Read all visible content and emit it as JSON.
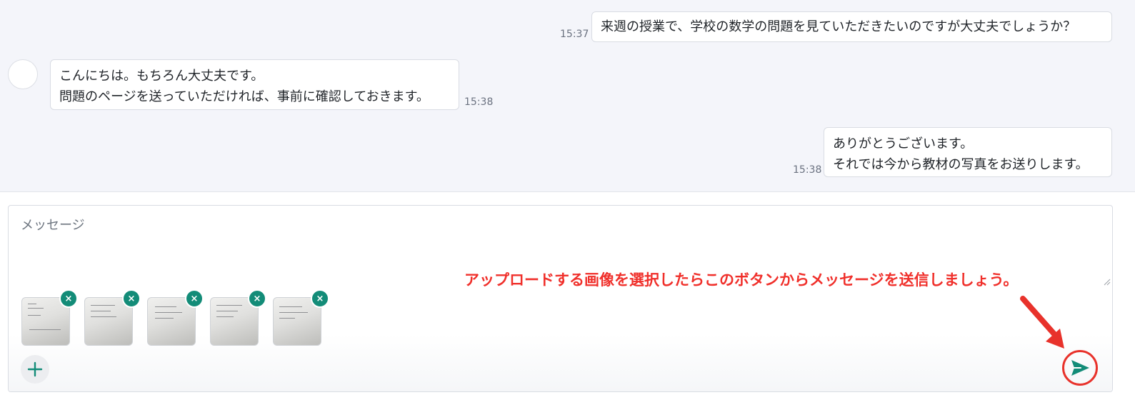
{
  "messages": [
    {
      "side": "right",
      "text": "来週の授業で、学校の数学の問題を見ていただきたいのですが大丈夫でしょうか？",
      "time": "15:37"
    },
    {
      "side": "left",
      "text": "こんにちは。もちろん大丈夫です。\n問題のページを送っていただければ、事前に確認しておきます。",
      "time": "15:38"
    },
    {
      "side": "right",
      "text": "ありがとうございます。\nそれでは今から教材の写真をお送りします。",
      "time": "15:38"
    }
  ],
  "composer": {
    "placeholder": "メッセージ",
    "attachments": [
      {
        "remove_label": "×"
      },
      {
        "remove_label": "×"
      },
      {
        "remove_label": "×"
      },
      {
        "remove_label": "×"
      },
      {
        "remove_label": "×"
      }
    ],
    "add_icon": "plus-icon",
    "send_icon": "paper-plane-icon"
  },
  "annotation": {
    "text": "アップロードする画像を選択したらこのボタンからメッセージを送信しましょう。"
  },
  "colors": {
    "accent": "#138c78",
    "annotation": "#f0302b",
    "chat_background": "#f4f5fa"
  }
}
